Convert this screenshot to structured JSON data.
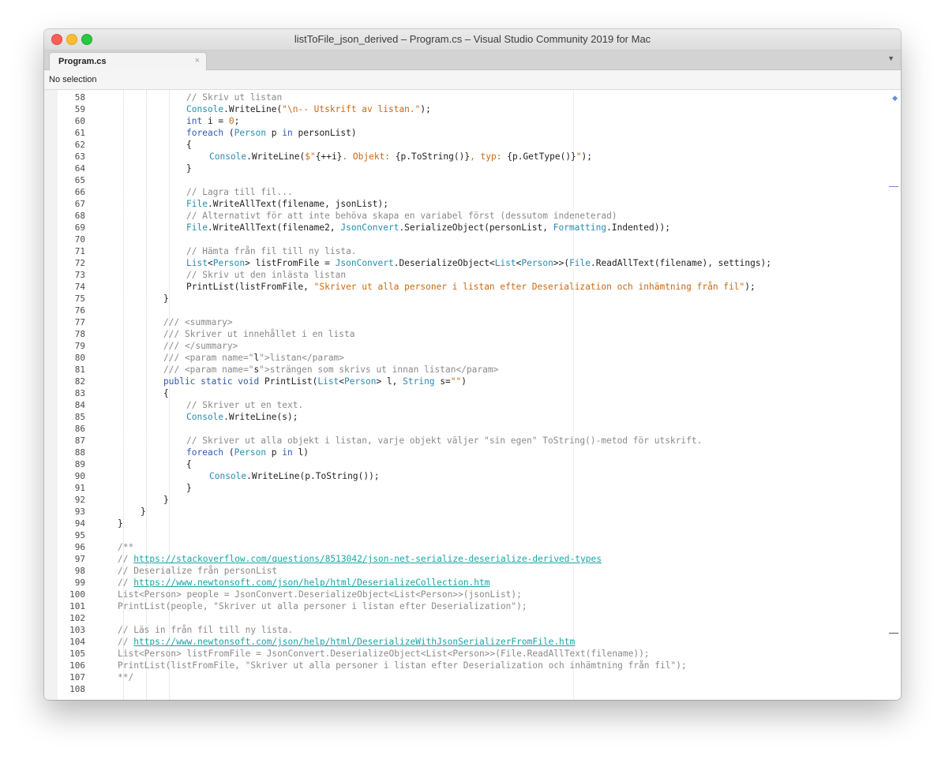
{
  "window": {
    "title": "listToFile_json_derived – Program.cs – Visual Studio Community 2019 for Mac"
  },
  "tabs": [
    {
      "label": "Program.cs",
      "close_glyph": "×"
    }
  ],
  "tab_menu_glyph": "▼",
  "breadcrumb": "No selection",
  "colors": {
    "keyword": "#2f5bb2",
    "type": "#2a8bb0",
    "string": "#c66a17",
    "comment": "#8a8a8a",
    "link": "#1aa5a5"
  },
  "code_lines": [
    {
      "n": "58",
      "i": 3,
      "t": [
        [
          "cm",
          "// Skriv ut listan"
        ]
      ]
    },
    {
      "n": "59",
      "i": 3,
      "t": [
        [
          "ty",
          "Console"
        ],
        [
          "",
          "."
        ],
        [
          "",
          "WriteLine("
        ],
        [
          "st",
          "\"\\n-- Utskrift av listan.\""
        ],
        [
          "",
          ");"
        ]
      ]
    },
    {
      "n": "60",
      "i": 3,
      "t": [
        [
          "kw",
          "int"
        ],
        [
          "",
          " i = "
        ],
        [
          "st",
          "0"
        ],
        [
          "",
          ";"
        ]
      ]
    },
    {
      "n": "61",
      "i": 3,
      "t": [
        [
          "kw",
          "foreach"
        ],
        [
          "",
          " ("
        ],
        [
          "ty",
          "Person"
        ],
        [
          "",
          " p "
        ],
        [
          "kw",
          "in"
        ],
        [
          "",
          " personList)"
        ]
      ]
    },
    {
      "n": "62",
      "i": 3,
      "t": [
        [
          "",
          "{"
        ]
      ]
    },
    {
      "n": "63",
      "i": 4,
      "t": [
        [
          "ty",
          "Console"
        ],
        [
          "",
          ".WriteLine("
        ],
        [
          "st",
          "$\""
        ],
        [
          "",
          "{++i}"
        ],
        [
          "st",
          ". Objekt: "
        ],
        [
          "",
          "{p.ToString()}"
        ],
        [
          "st",
          ", typ: "
        ],
        [
          "",
          "{p.GetType()}"
        ],
        [
          "st",
          "\""
        ],
        [
          "",
          ");"
        ]
      ]
    },
    {
      "n": "64",
      "i": 3,
      "t": [
        [
          "",
          "}"
        ]
      ]
    },
    {
      "n": "65",
      "i": 0,
      "t": []
    },
    {
      "n": "66",
      "i": 3,
      "t": [
        [
          "cm",
          "// Lagra till fil..."
        ]
      ]
    },
    {
      "n": "67",
      "i": 3,
      "t": [
        [
          "ty",
          "File"
        ],
        [
          "",
          ".WriteAllText(filename, jsonList);"
        ]
      ]
    },
    {
      "n": "68",
      "i": 3,
      "t": [
        [
          "cm",
          "// Alternativt för att inte behöva skapa en variabel först (dessutom indeneterad)"
        ]
      ]
    },
    {
      "n": "69",
      "i": 3,
      "t": [
        [
          "ty",
          "File"
        ],
        [
          "",
          ".WriteAllText(filename2, "
        ],
        [
          "ty",
          "JsonConvert"
        ],
        [
          "",
          ".SerializeObject(personList, "
        ],
        [
          "ty",
          "Formatting"
        ],
        [
          "",
          ".Indented));"
        ]
      ]
    },
    {
      "n": "70",
      "i": 0,
      "t": []
    },
    {
      "n": "71",
      "i": 3,
      "t": [
        [
          "cm",
          "// Hämta från fil till ny lista."
        ]
      ]
    },
    {
      "n": "72",
      "i": 3,
      "t": [
        [
          "ty",
          "List"
        ],
        [
          "",
          "<"
        ],
        [
          "ty",
          "Person"
        ],
        [
          "",
          "> listFromFile = "
        ],
        [
          "ty",
          "JsonConvert"
        ],
        [
          "",
          ".DeserializeObject<"
        ],
        [
          "ty",
          "List"
        ],
        [
          "",
          "<"
        ],
        [
          "ty",
          "Person"
        ],
        [
          "",
          ">>("
        ],
        [
          "ty",
          "File"
        ],
        [
          "",
          ".ReadAllText(filename), settings);"
        ]
      ]
    },
    {
      "n": "73",
      "i": 3,
      "t": [
        [
          "cm",
          "// Skriv ut den inlästa listan"
        ]
      ]
    },
    {
      "n": "74",
      "i": 3,
      "t": [
        [
          "",
          "PrintList(listFromFile, "
        ],
        [
          "st",
          "\"Skriver ut alla personer i listan efter Deserialization och inhämtning från fil\""
        ],
        [
          "",
          ");"
        ]
      ]
    },
    {
      "n": "75",
      "i": 2,
      "t": [
        [
          "",
          "}"
        ]
      ]
    },
    {
      "n": "76",
      "i": 0,
      "t": []
    },
    {
      "n": "77",
      "i": 2,
      "t": [
        [
          "cm",
          "/// <summary>"
        ]
      ]
    },
    {
      "n": "78",
      "i": 2,
      "t": [
        [
          "cm",
          "/// Skriver ut innehållet i en lista"
        ]
      ]
    },
    {
      "n": "79",
      "i": 2,
      "t": [
        [
          "cm",
          "/// </summary>"
        ]
      ]
    },
    {
      "n": "80",
      "i": 2,
      "t": [
        [
          "cm",
          "/// <param name=\""
        ],
        [
          "",
          "l"
        ],
        [
          "cm",
          "\">listan</param>"
        ]
      ]
    },
    {
      "n": "81",
      "i": 2,
      "t": [
        [
          "cm",
          "/// <param name=\""
        ],
        [
          "",
          "s"
        ],
        [
          "cm",
          "\">strängen som skrivs ut innan listan</param>"
        ]
      ]
    },
    {
      "n": "82",
      "i": 2,
      "t": [
        [
          "kw",
          "public static void"
        ],
        [
          "",
          " PrintList("
        ],
        [
          "ty",
          "List"
        ],
        [
          "",
          "<"
        ],
        [
          "ty",
          "Person"
        ],
        [
          "",
          "> l, "
        ],
        [
          "ty",
          "String"
        ],
        [
          "",
          " s="
        ],
        [
          "st",
          "\"\""
        ],
        [
          "",
          ")"
        ]
      ]
    },
    {
      "n": "83",
      "i": 2,
      "t": [
        [
          "",
          "{"
        ]
      ]
    },
    {
      "n": "84",
      "i": 3,
      "t": [
        [
          "cm",
          "// Skriver ut en text."
        ]
      ]
    },
    {
      "n": "85",
      "i": 3,
      "t": [
        [
          "ty",
          "Console"
        ],
        [
          "",
          ".WriteLine(s);"
        ]
      ]
    },
    {
      "n": "86",
      "i": 0,
      "t": []
    },
    {
      "n": "87",
      "i": 3,
      "t": [
        [
          "cm",
          "// Skriver ut alla objekt i listan, varje objekt väljer \"sin egen\" ToString()-metod för utskrift."
        ]
      ]
    },
    {
      "n": "88",
      "i": 3,
      "t": [
        [
          "kw",
          "foreach"
        ],
        [
          "",
          " ("
        ],
        [
          "ty",
          "Person"
        ],
        [
          "",
          " p "
        ],
        [
          "kw",
          "in"
        ],
        [
          "",
          " l)"
        ]
      ]
    },
    {
      "n": "89",
      "i": 3,
      "t": [
        [
          "",
          "{"
        ]
      ]
    },
    {
      "n": "90",
      "i": 4,
      "t": [
        [
          "ty",
          "Console"
        ],
        [
          "",
          ".WriteLine(p.ToString());"
        ]
      ]
    },
    {
      "n": "91",
      "i": 3,
      "t": [
        [
          "",
          "}"
        ]
      ]
    },
    {
      "n": "92",
      "i": 2,
      "t": [
        [
          "",
          "}"
        ]
      ]
    },
    {
      "n": "93",
      "i": 1,
      "t": [
        [
          "",
          "}"
        ]
      ]
    },
    {
      "n": "94",
      "i": 0,
      "t": [
        [
          "",
          "}"
        ]
      ]
    },
    {
      "n": "95",
      "i": 0,
      "t": []
    },
    {
      "n": "96",
      "i": 0,
      "t": [
        [
          "cm",
          "/**"
        ]
      ]
    },
    {
      "n": "97",
      "i": 0,
      "t": [
        [
          "cm",
          "// "
        ],
        [
          "lnk",
          "https://stackoverflow.com/questions/8513042/json-net-serialize-deserialize-derived-types"
        ]
      ]
    },
    {
      "n": "98",
      "i": 0,
      "t": [
        [
          "cm",
          "// Deserialize från personList"
        ]
      ]
    },
    {
      "n": "99",
      "i": 0,
      "t": [
        [
          "cm",
          "// "
        ],
        [
          "lnk",
          "https://www.newtonsoft.com/json/help/html/DeserializeCollection.htm"
        ]
      ]
    },
    {
      "n": "100",
      "i": 0,
      "t": [
        [
          "cm",
          "List<Person> people = JsonConvert.DeserializeObject<List<Person>>(jsonList);"
        ]
      ]
    },
    {
      "n": "101",
      "i": 0,
      "t": [
        [
          "cm",
          "PrintList(people, \"Skriver ut alla personer i listan efter Deserialization\");"
        ]
      ]
    },
    {
      "n": "102",
      "i": 0,
      "t": []
    },
    {
      "n": "103",
      "i": 0,
      "t": [
        [
          "cm",
          "// Läs in från fil till ny lista."
        ]
      ]
    },
    {
      "n": "104",
      "i": 0,
      "t": [
        [
          "cm",
          "// "
        ],
        [
          "lnk",
          "https://www.newtonsoft.com/json/help/html/DeserializeWithJsonSerializerFromFile.htm"
        ]
      ]
    },
    {
      "n": "105",
      "i": 0,
      "t": [
        [
          "cm",
          "List<Person> listFromFile = JsonConvert.DeserializeObject<List<Person>>(File.ReadAllText(filename));"
        ]
      ]
    },
    {
      "n": "106",
      "i": 0,
      "t": [
        [
          "cm",
          "PrintList(listFromFile, \"Skriver ut alla personer i listan efter Deserialization och inhämtning från fil\");"
        ]
      ]
    },
    {
      "n": "107",
      "i": 0,
      "t": [
        [
          "cm",
          "**/"
        ]
      ]
    },
    {
      "n": "108",
      "i": 0,
      "t": []
    }
  ]
}
